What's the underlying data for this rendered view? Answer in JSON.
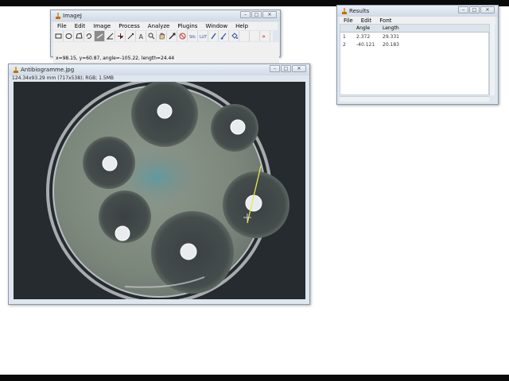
{
  "imagej": {
    "title": "ImageJ",
    "menu": [
      "File",
      "Edit",
      "Image",
      "Process",
      "Analyze",
      "Plugins",
      "Window",
      "Help"
    ],
    "tools": [
      "rectangle-tool-icon",
      "oval-tool-icon",
      "polygon-tool-icon",
      "freehand-tool-icon",
      "straight-line-tool-icon",
      "angle-tool-icon",
      "point-tool-icon",
      "wand-tool-icon",
      "text-tool-icon",
      "magnifier-tool-icon",
      "hand-tool-icon",
      "color-picker-icon",
      "stop-icon",
      "lut-icon",
      "developer-menu-icon",
      "pencil-icon",
      "brush-icon",
      "flood-fill-icon",
      "more-tools-icon"
    ],
    "status": "x=98.15, y=60.87, angle=-105.22, length=24.44"
  },
  "image_window": {
    "title": "Antibiogramme.jpg",
    "info": "124.34x93.29 mm (717x538); RGB; 1.5MB"
  },
  "results": {
    "title": "Results",
    "menu": [
      "File",
      "Edit",
      "Font"
    ],
    "columns": [
      "",
      "Angle",
      "Length"
    ],
    "rows": [
      {
        "n": "1",
        "angle": "2.372",
        "length": "29.331"
      },
      {
        "n": "2",
        "angle": "-40.121",
        "length": "20.183"
      }
    ]
  },
  "colors": {
    "selected_tool": "#8b8b8b",
    "measure_line": "#e8e84a",
    "agar": "#7f8b7f",
    "zone": "#3a3f40"
  }
}
